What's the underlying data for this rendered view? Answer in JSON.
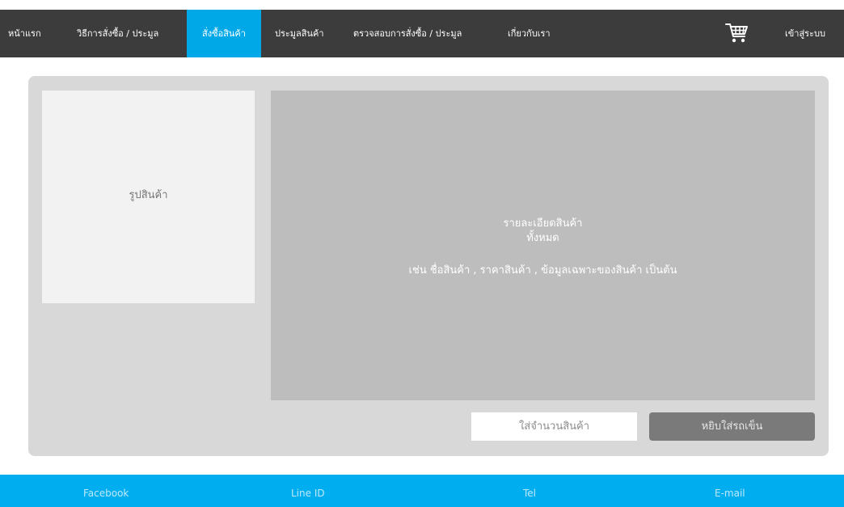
{
  "nav": {
    "items": [
      {
        "label": "หน้าแรก"
      },
      {
        "label": "วิธีการสั่งซื้อ / ประมูล"
      },
      {
        "label": "สั่งซื้อสินค้า"
      },
      {
        "label": "ประมูลสินค้า"
      },
      {
        "label": "ตรวจสอบการสั่งซื้อ / ประมูล"
      },
      {
        "label": "เกี่ยวกับเรา"
      }
    ],
    "active_index": 2,
    "login_label": "เข้าสู่ระบบ",
    "cart_icon": "shopping-cart-icon"
  },
  "product": {
    "image_label": "รูปสินค้า",
    "detail_lines": [
      "รายละเอียดสินค้า",
      "ทั้งหมด",
      "เช่น ชื่อสินค้า , ราคาสินค้า , ข้อมูลเฉพาะของสินค้า เป็นต้น"
    ],
    "quantity_placeholder": "ใส่จำนวนสินค้า",
    "add_to_cart_label": "หยิบใส่รถเข็น"
  },
  "footer": {
    "items": [
      {
        "label": "Facebook"
      },
      {
        "label": "Line ID"
      },
      {
        "label": "Tel"
      },
      {
        "label": "E-mail"
      }
    ]
  },
  "colors": {
    "nav_bg": "#3c3c3c",
    "accent": "#00a8e8",
    "footer_bg": "#00aeef",
    "panel_bg": "#d8d8d8",
    "detail_bg": "#bdbdbd",
    "button_bg": "#7a7a7a"
  }
}
